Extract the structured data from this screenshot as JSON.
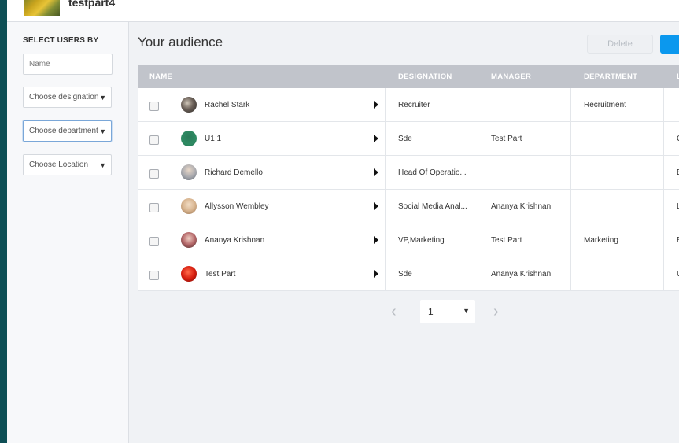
{
  "app": {
    "title": "testpart4"
  },
  "sidebar": {
    "heading": "SELECT USERS BY",
    "name_placeholder": "Name",
    "designation_select": "Choose designation",
    "department_select": "Choose department",
    "location_select": "Choose Location"
  },
  "main": {
    "title": "Your audience",
    "delete_label": "Delete",
    "columns": [
      "NAME",
      "DESIGNATION",
      "MANAGER",
      "DEPARTMENT",
      "L"
    ],
    "rows": [
      {
        "name": "Rachel Stark",
        "designation": "Recruiter",
        "manager": "",
        "department": "Recruitment",
        "loc": ""
      },
      {
        "name": "U1 1",
        "designation": "Sde",
        "manager": "Test Part",
        "department": "",
        "loc": "C"
      },
      {
        "name": "Richard Demello",
        "designation": "Head Of Operatio...",
        "manager": "",
        "department": "",
        "loc": "B"
      },
      {
        "name": "Allysson Wembley",
        "designation": "Social Media Anal...",
        "manager": "Ananya Krishnan",
        "department": "",
        "loc": "L"
      },
      {
        "name": "Ananya Krishnan",
        "designation": "VP,Marketing",
        "manager": "Test Part",
        "department": "Marketing",
        "loc": "B"
      },
      {
        "name": "Test Part",
        "designation": "Sde",
        "manager": "Ananya Krishnan",
        "department": "",
        "loc": "U"
      }
    ]
  },
  "pagination": {
    "page": "1"
  },
  "colors": {
    "accent": "#0b98ee",
    "header": "#c1c4cb",
    "strip": "#0e4f55"
  },
  "avatars": [
    "radial-gradient(circle at 40% 40%, #cfc6b8 0%, #6b6058 45%, #2d2a27 100%)",
    "radial-gradient(circle at 50% 40%, #2a7a58 0%, #2e8b63 60%, #1f6a4b 100%)",
    "radial-gradient(circle at 50% 35%, #e8d7c8 0%, #a7a8ad 55%, #5f6772 100%)",
    "radial-gradient(circle at 50% 40%, #f1dcc4 0%, #d8b590 50%, #9a7350 100%)",
    "radial-gradient(circle at 50% 40%, #f0cfc3 0%, #b5686a 50%, #4b2a2a 100%)",
    "radial-gradient(circle at 45% 40%, #ff6a4a 0%, #d81f10 50%, #7a0a05 100%)"
  ]
}
